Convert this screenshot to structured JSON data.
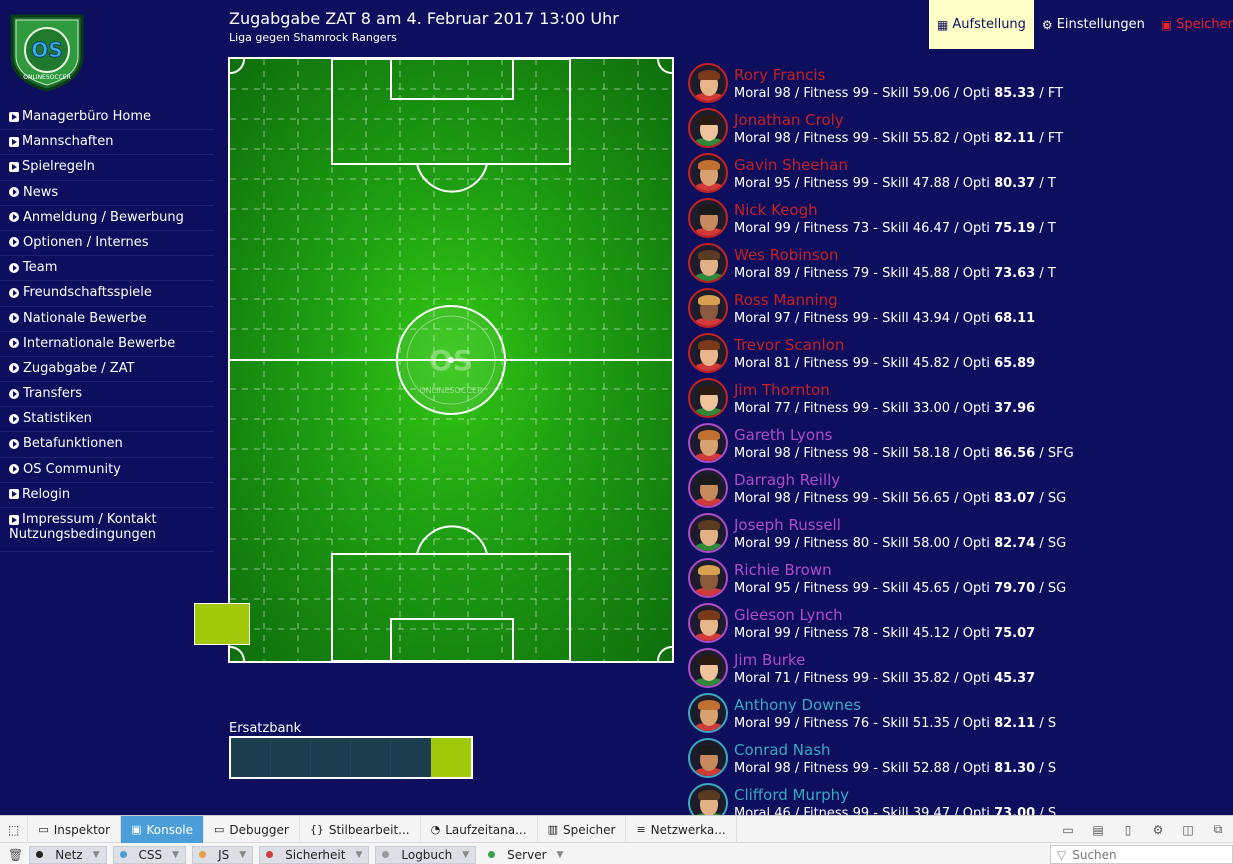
{
  "header": {
    "title": "Zugabgabe ZAT 8 am 4. Februar 2017 13:00 Uhr",
    "subtitle": "Liga gegen Shamrock Rangers",
    "nav": [
      {
        "label": "Aufstellung",
        "icon": "grid-icon"
      },
      {
        "label": "Einstellungen",
        "icon": "gear-icon"
      },
      {
        "label": "Speicher",
        "icon": "save-icon"
      }
    ]
  },
  "sidebar": {
    "items": [
      {
        "label": "Managerbüro Home",
        "icon": "square-play-icon"
      },
      {
        "label": "Mannschaften",
        "icon": "square-play-icon"
      },
      {
        "label": "Spielregeln",
        "icon": "square-play-icon"
      },
      {
        "label": "News",
        "icon": "circle-play-icon"
      },
      {
        "label": "Anmeldung / Bewerbung",
        "icon": "circle-play-icon"
      },
      {
        "label": "Optionen / Internes",
        "icon": "circle-play-icon"
      },
      {
        "label": "Team",
        "icon": "circle-play-icon"
      },
      {
        "label": "Freundschaftsspiele",
        "icon": "circle-play-icon"
      },
      {
        "label": "Nationale Bewerbe",
        "icon": "circle-play-icon"
      },
      {
        "label": "Internationale Bewerbe",
        "icon": "circle-play-icon"
      },
      {
        "label": "Zugabgabe / ZAT",
        "icon": "circle-play-icon"
      },
      {
        "label": "Transfers",
        "icon": "circle-play-icon"
      },
      {
        "label": "Statistiken",
        "icon": "circle-play-icon"
      },
      {
        "label": "Betafunktionen",
        "icon": "circle-play-icon"
      },
      {
        "label": "OS Community",
        "icon": "circle-play-icon"
      },
      {
        "label": "Relogin",
        "icon": "square-play-icon"
      },
      {
        "label": "Impressum / Kontakt",
        "label2": "Nutzungsbedingungen",
        "icon": "square-play-icon"
      }
    ]
  },
  "bench": {
    "label": "Ersatzbank"
  },
  "players": [
    {
      "name": "Rory Francis",
      "moral": "98",
      "fitness": "99",
      "skill": "59.06",
      "opti": "85.33",
      "pos": "FT",
      "group_color": "#c62020"
    },
    {
      "name": "Jonathan Croly",
      "moral": "98",
      "fitness": "99",
      "skill": "55.82",
      "opti": "82.11",
      "pos": "FT",
      "group_color": "#c62020"
    },
    {
      "name": "Gavin Sheehan",
      "moral": "95",
      "fitness": "99",
      "skill": "47.88",
      "opti": "80.37",
      "pos": "T",
      "group_color": "#c62020"
    },
    {
      "name": "Nick Keogh",
      "moral": "99",
      "fitness": "73",
      "skill": "46.47",
      "opti": "75.19",
      "pos": "T",
      "group_color": "#c62020"
    },
    {
      "name": "Wes Robinson",
      "moral": "89",
      "fitness": "79",
      "skill": "45.88",
      "opti": "73.63",
      "pos": "T",
      "group_color": "#c62020"
    },
    {
      "name": "Ross Manning",
      "moral": "97",
      "fitness": "99",
      "skill": "43.94",
      "opti": "68.11",
      "pos": "",
      "group_color": "#c62020"
    },
    {
      "name": "Trevor Scanlon",
      "moral": "81",
      "fitness": "99",
      "skill": "45.82",
      "opti": "65.89",
      "pos": "",
      "group_color": "#c62020"
    },
    {
      "name": "Jim Thornton",
      "moral": "77",
      "fitness": "99",
      "skill": "33.00",
      "opti": "37.96",
      "pos": "",
      "group_color": "#c62020"
    },
    {
      "name": "Gareth Lyons",
      "moral": "98",
      "fitness": "98",
      "skill": "58.18",
      "opti": "86.56",
      "pos": "SFG",
      "group_color": "#b04ac8"
    },
    {
      "name": "Darragh Reilly",
      "moral": "98",
      "fitness": "99",
      "skill": "56.65",
      "opti": "83.07",
      "pos": "SG",
      "group_color": "#b04ac8"
    },
    {
      "name": "Joseph Russell",
      "moral": "99",
      "fitness": "80",
      "skill": "58.00",
      "opti": "82.74",
      "pos": "SG",
      "group_color": "#b04ac8"
    },
    {
      "name": "Richie Brown",
      "moral": "95",
      "fitness": "99",
      "skill": "45.65",
      "opti": "79.70",
      "pos": "SG",
      "group_color": "#b04ac8"
    },
    {
      "name": "Gleeson Lynch",
      "moral": "99",
      "fitness": "78",
      "skill": "45.12",
      "opti": "75.07",
      "pos": "",
      "group_color": "#b04ac8"
    },
    {
      "name": "Jim Burke",
      "moral": "71",
      "fitness": "99",
      "skill": "35.82",
      "opti": "45.37",
      "pos": "",
      "group_color": "#b04ac8"
    },
    {
      "name": "Anthony Downes",
      "moral": "99",
      "fitness": "76",
      "skill": "51.35",
      "opti": "82.11",
      "pos": "S",
      "group_color": "#3aa8c0"
    },
    {
      "name": "Conrad Nash",
      "moral": "98",
      "fitness": "99",
      "skill": "52.88",
      "opti": "81.30",
      "pos": "S",
      "group_color": "#3aa8c0"
    },
    {
      "name": "Clifford Murphy",
      "moral": "46",
      "fitness": "99",
      "skill": "39.47",
      "opti": "73.00",
      "pos": "S",
      "group_color": "#3aa8c0"
    }
  ],
  "stat_labels": {
    "moral": "Moral",
    "fitness": "Fitness",
    "skill": "Skill",
    "opti": "Opti"
  },
  "devtools": {
    "tabs": [
      {
        "label": "Inspektor",
        "icon": "inspector-icon"
      },
      {
        "label": "Konsole",
        "icon": "console-icon"
      },
      {
        "label": "Debugger",
        "icon": "debugger-icon"
      },
      {
        "label": "Stilbearbeit...",
        "icon": "style-editor-icon"
      },
      {
        "label": "Laufzeitana...",
        "icon": "performance-icon"
      },
      {
        "label": "Speicher",
        "icon": "memory-icon"
      },
      {
        "label": "Netzwerka...",
        "icon": "network-icon"
      }
    ],
    "active_tab": "Konsole",
    "filters": [
      {
        "label": "Netz",
        "color": "#222222"
      },
      {
        "label": "CSS",
        "color": "#4c9ed9"
      },
      {
        "label": "JS",
        "color": "#e8a040"
      },
      {
        "label": "Sicherheit",
        "color": "#d13c3c"
      },
      {
        "label": "Logbuch",
        "color": "#9a9a9a"
      },
      {
        "label": "Server",
        "color": "#3aa34a"
      }
    ],
    "search_placeholder": "Suchen"
  }
}
